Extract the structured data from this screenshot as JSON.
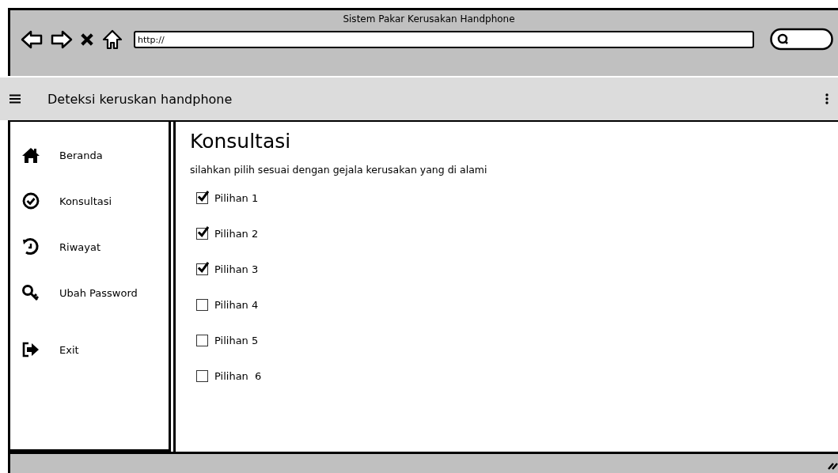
{
  "window": {
    "title": "Sistem Pakar Kerusakan Handphone"
  },
  "address_bar": {
    "value": "http://"
  },
  "app_bar": {
    "title": "Deteksi keruskan handphone"
  },
  "sidebar": {
    "items": [
      {
        "label": "Beranda",
        "selected": false
      },
      {
        "label": "Konsultasi",
        "selected": false
      },
      {
        "label": "Riwayat",
        "selected": false
      },
      {
        "label": "Ubah Password",
        "selected": false
      },
      {
        "label": "Exit",
        "selected": false
      }
    ]
  },
  "content": {
    "heading": "Konsultasi",
    "instruction": "silahkan pilih sesuai dengan gejala kerusakan yang di alami",
    "options": [
      {
        "label": "Pilihan 1",
        "checked": true
      },
      {
        "label": "Pilihan 2",
        "checked": true
      },
      {
        "label": "Pilihan 3",
        "checked": true
      },
      {
        "label": "Pilihan 4",
        "checked": false
      },
      {
        "label": "Pilihan 5",
        "checked": false
      },
      {
        "label": "Pilihan  6",
        "checked": false
      }
    ]
  }
}
